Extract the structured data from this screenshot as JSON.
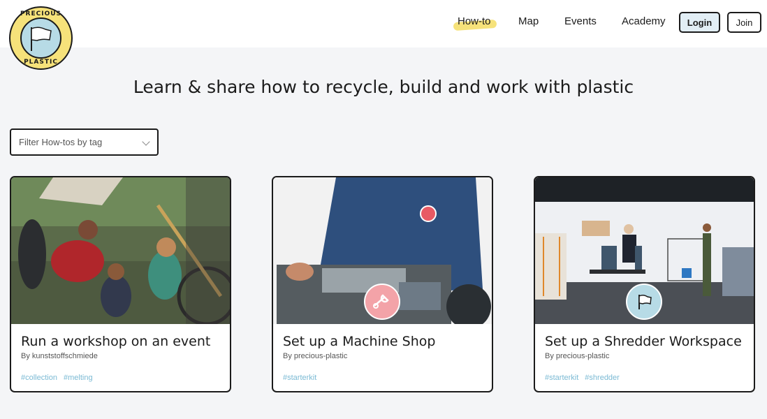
{
  "logo": {
    "top_text": "PRECIOUS",
    "bottom_text": "PLASTIC"
  },
  "nav": {
    "items": [
      {
        "label": "How-to",
        "active": true
      },
      {
        "label": "Map"
      },
      {
        "label": "Events"
      },
      {
        "label": "Academy"
      }
    ],
    "login_label": "Login",
    "join_label": "Join"
  },
  "title": "Learn & share how to recycle, build and work with plastic",
  "filter": {
    "placeholder": "Filter How-tos by tag"
  },
  "cards": [
    {
      "title": "Run a workshop on an event",
      "author": "By kunststoffschmiede",
      "tags": [
        "#collection",
        "#melting"
      ]
    },
    {
      "title": "Set up a Machine Shop",
      "author": "By precious-plastic",
      "tags": [
        "#starterkit"
      ],
      "badge_icon": "wrench-icon",
      "badge_color": "#f3a3a8"
    },
    {
      "title": "Set up a Shredder Workspace",
      "author": "By precious-plastic",
      "tags": [
        "#starterkit",
        "#shredder"
      ],
      "badge_icon": "flag-icon",
      "badge_color": "#b7dbe6"
    }
  ],
  "colors": {
    "accent_yellow": "#f6e27a",
    "tag_blue": "#7bbad4",
    "login_bg": "#e2eef5"
  }
}
